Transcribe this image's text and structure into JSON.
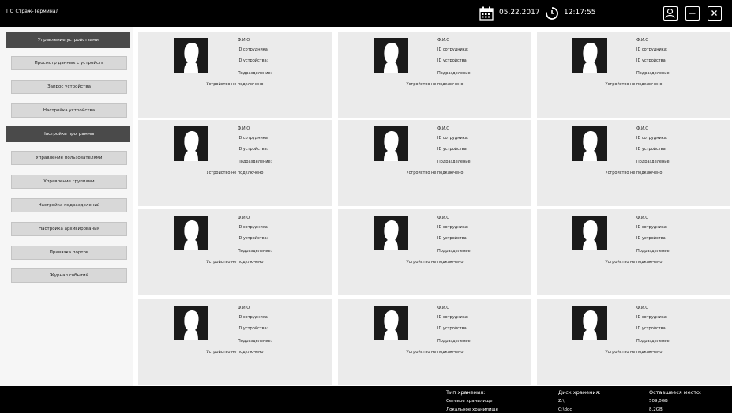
{
  "app": {
    "title": "ПО Страж-Терминал"
  },
  "header": {
    "date": "05.22.2017",
    "time": "12:17:55"
  },
  "sidebar": {
    "sections": [
      {
        "label": "Управление устройствами",
        "items": [
          "Просмотр данных с устройств",
          "Запрос устройства",
          "Настройка устройства"
        ]
      },
      {
        "label": "Настройки программы",
        "items": [
          "Управление пользователями",
          "Управление группами",
          "Настройка подразделений",
          "Настройка архивирования",
          "Привязка портов",
          "Журнал событий"
        ]
      }
    ]
  },
  "device_card": {
    "fio_label": "Ф.И.О",
    "employee_id_label": "ID сотрудника:",
    "device_id_label": "ID устройства:",
    "department_label": "Подразделение:",
    "status": "Устройство не подключено"
  },
  "footer": {
    "storage_type_header": "Тип хранения:",
    "storage_disk_header": "Диск хранения:",
    "free_space_header": "Оставшееся место:",
    "rows": [
      {
        "type": "Сетевое хранилище",
        "disk": "Z:\\",
        "free": "509,0GB"
      },
      {
        "type": "Локальное хранилище",
        "disk": "C:\\doc",
        "free": "8,2GB"
      }
    ]
  },
  "icons": {
    "calendar": "calendar-icon",
    "clock": "clock-icon",
    "user": "user-icon",
    "minimize": "minimize-icon",
    "close": "close-icon",
    "avatar": "avatar-silhouette-icon"
  },
  "colors": {
    "bar_bg": "#000000",
    "section_bg": "#4a4a4a",
    "item_bg": "#d8d8d8",
    "card_bg": "#ebebeb"
  }
}
